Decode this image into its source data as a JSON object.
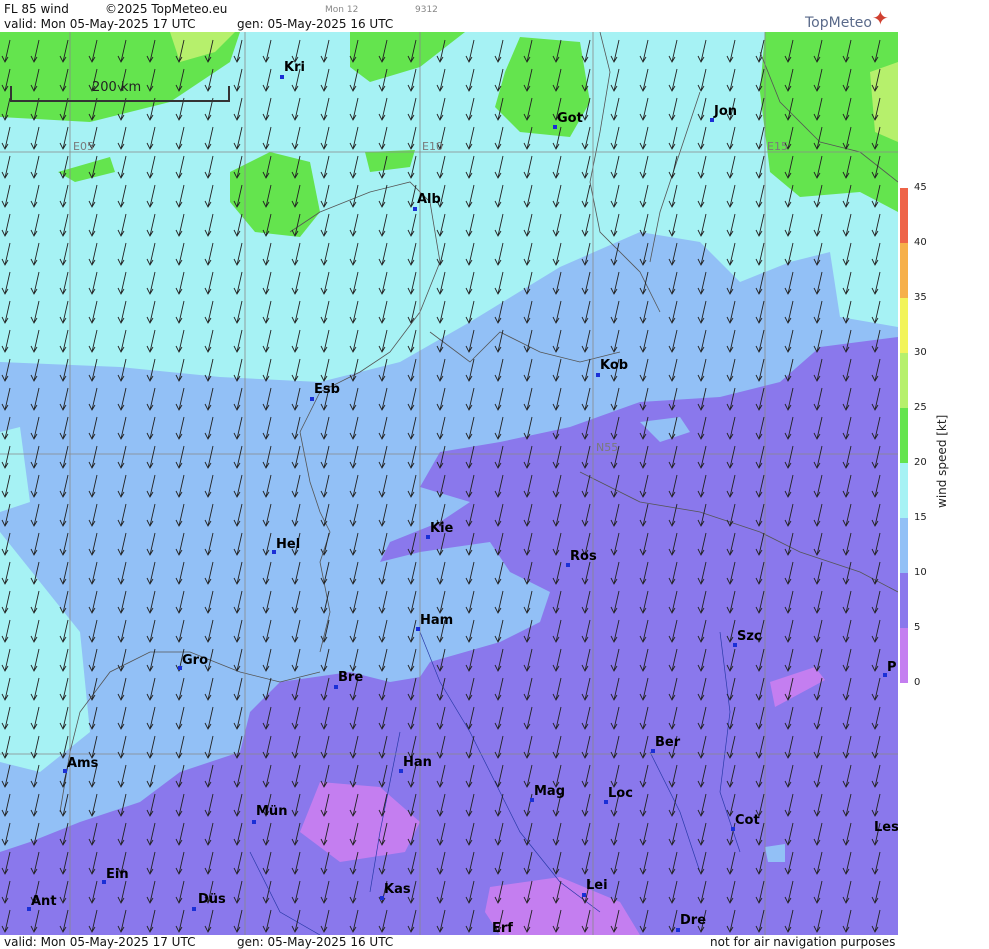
{
  "header": {
    "product": "FL 85 wind",
    "copyright": "©2025 TopMeteo.eu",
    "valid": "valid:  Mon  05-May-2025  17 UTC",
    "gen": "gen:  05-May-2025 16 UTC",
    "run_tag": "Mon 12",
    "code": "9312",
    "logo": "TopMeteo"
  },
  "footer": {
    "valid": "valid:  Mon  05-May-2025  17 UTC",
    "gen": "gen:  05-May-2025 16 UTC",
    "disclaimer": "not for air navigation purposes"
  },
  "scale": {
    "label": "200 km"
  },
  "grid_labels": [
    {
      "id": "e05",
      "text": "E05"
    },
    {
      "id": "e10",
      "text": "E10"
    },
    {
      "id": "e15",
      "text": "E15"
    },
    {
      "id": "n55",
      "text": "N55"
    }
  ],
  "cities": [
    {
      "id": "kri",
      "name": "Kri"
    },
    {
      "id": "got",
      "name": "Got"
    },
    {
      "id": "jon",
      "name": "Jon"
    },
    {
      "id": "alb",
      "name": "Alb"
    },
    {
      "id": "esb",
      "name": "Esb"
    },
    {
      "id": "kob",
      "name": "Kob"
    },
    {
      "id": "kie",
      "name": "Kie"
    },
    {
      "id": "hel",
      "name": "Hel"
    },
    {
      "id": "ros",
      "name": "Ros"
    },
    {
      "id": "ham",
      "name": "Ham"
    },
    {
      "id": "szc",
      "name": "Szc"
    },
    {
      "id": "gro",
      "name": "Gro"
    },
    {
      "id": "bre",
      "name": "Bre"
    },
    {
      "id": "p",
      "name": "P"
    },
    {
      "id": "ber",
      "name": "Ber"
    },
    {
      "id": "ams",
      "name": "Ams"
    },
    {
      "id": "han",
      "name": "Han"
    },
    {
      "id": "mag",
      "name": "Mag"
    },
    {
      "id": "loc",
      "name": "Loc"
    },
    {
      "id": "mun",
      "name": "Mün"
    },
    {
      "id": "cot",
      "name": "Cot"
    },
    {
      "id": "les",
      "name": "Les"
    },
    {
      "id": "ein",
      "name": "Ein"
    },
    {
      "id": "lei",
      "name": "Lei"
    },
    {
      "id": "kas",
      "name": "Kas"
    },
    {
      "id": "ant",
      "name": "Ant"
    },
    {
      "id": "dus",
      "name": "Düs"
    },
    {
      "id": "dre",
      "name": "Dre"
    },
    {
      "id": "erf",
      "name": "Erf"
    }
  ],
  "legend": {
    "title": "wind speed [kt]",
    "ticks": [
      "45",
      "40",
      "35",
      "30",
      "25",
      "20",
      "15",
      "10",
      "5",
      "0"
    ],
    "colors": {
      "c0_5": "#c47ef0",
      "c5_10": "#8a78ec",
      "c10_15": "#92c0f6",
      "c15_20": "#a6f2f4",
      "c20_25": "#64e44e",
      "c25_30": "#b6f06c",
      "c30_35": "#f2f45a",
      "c35_40": "#f6b04a",
      "c40_45": "#ee6448"
    }
  },
  "wind_direction": "north-northeast"
}
